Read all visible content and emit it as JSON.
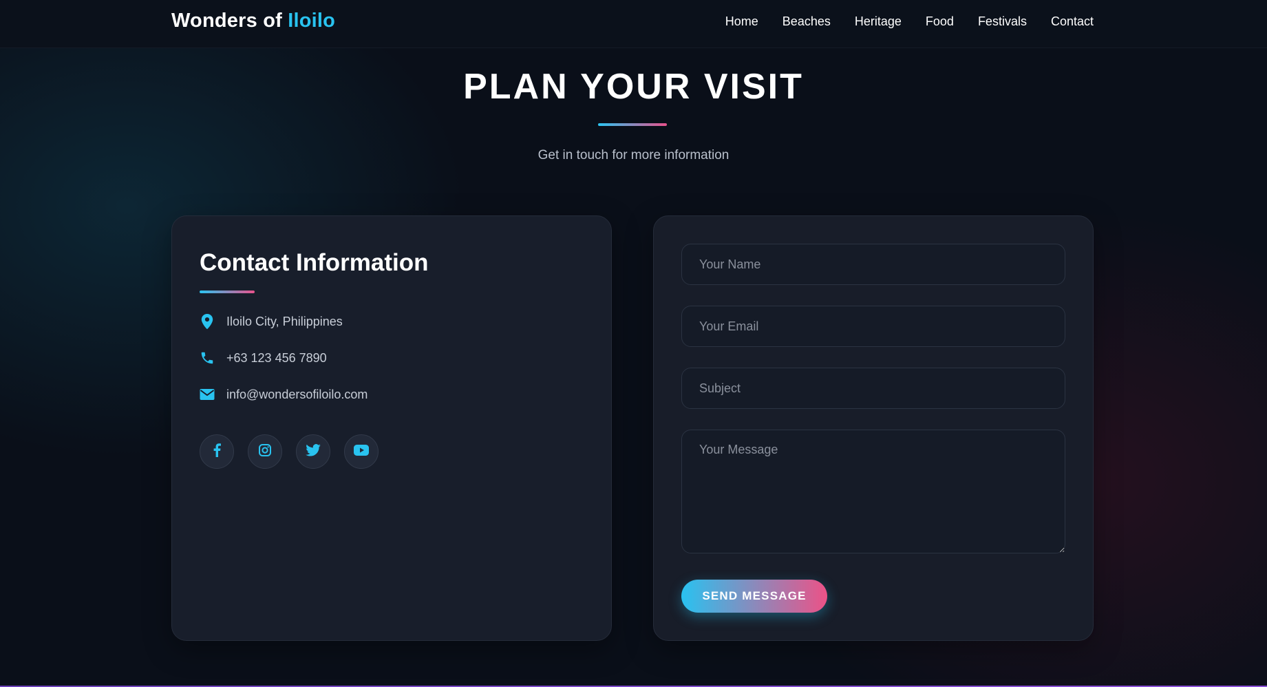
{
  "nav": {
    "brand_main": "Wonders of ",
    "brand_accent": "Iloilo",
    "links": [
      "Home",
      "Beaches",
      "Heritage",
      "Food",
      "Festivals",
      "Contact"
    ]
  },
  "section": {
    "title": "PLAN YOUR VISIT",
    "subtitle": "Get in touch for more information"
  },
  "contact_info": {
    "title": "Contact Information",
    "items": [
      {
        "icon": "map-pin-icon",
        "text": "Iloilo City, Philippines"
      },
      {
        "icon": "phone-icon",
        "text": "+63 123 456 7890"
      },
      {
        "icon": "envelope-icon",
        "text": "info@wondersofiloilo.com"
      }
    ],
    "socials": [
      "facebook-icon",
      "instagram-icon",
      "twitter-icon",
      "youtube-icon"
    ]
  },
  "form": {
    "name_placeholder": "Your Name",
    "email_placeholder": "Your Email",
    "subject_placeholder": "Subject",
    "message_placeholder": "Your Message",
    "send_label": "SEND MESSAGE"
  },
  "colors": {
    "accent_cyan": "#29c3f0",
    "accent_pink": "#e8528c",
    "card_bg": "#181e2b",
    "page_bg": "#0a0f19"
  }
}
